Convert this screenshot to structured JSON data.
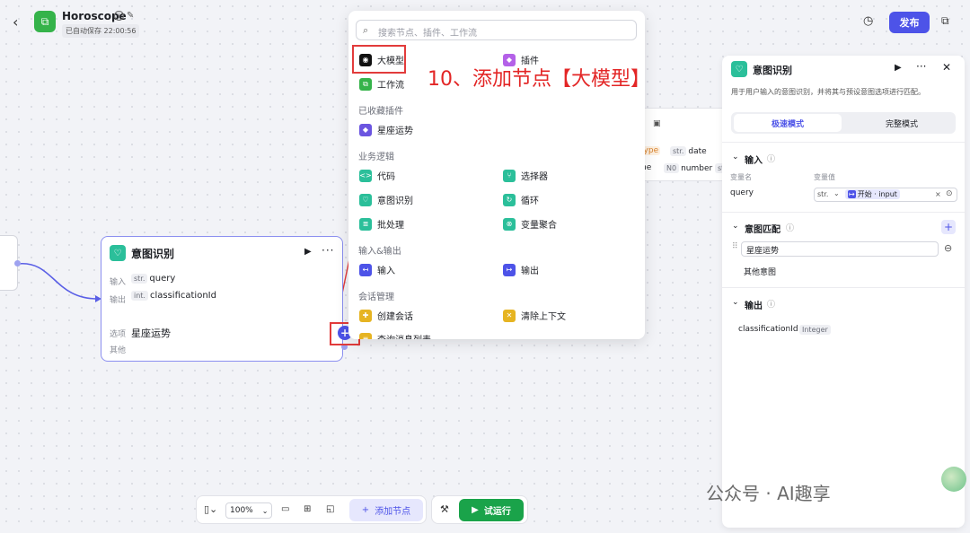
{
  "header": {
    "title": "Horoscope",
    "saved": "已自动保存 22:00:56",
    "publish": "发布"
  },
  "node": {
    "title": "意图识别",
    "input_label": "输入",
    "input_type": "str.",
    "input_name": "query",
    "output_label": "输出",
    "output_type": "int.",
    "output_name": "classificationId",
    "option_label": "选项",
    "option_value": "星座运势",
    "other_label": "其他"
  },
  "popup": {
    "search_placeholder": "搜索节点、插件、工作流",
    "top_items": [
      {
        "label": "大模型"
      },
      {
        "label": "插件"
      },
      {
        "label": "工作流"
      }
    ],
    "sections": [
      {
        "title": "已收藏插件",
        "items": [
          "星座运势"
        ]
      },
      {
        "title": "业务逻辑",
        "items": [
          "代码",
          "选择器",
          "意图识别",
          "循环",
          "批处理",
          "变量聚合"
        ]
      },
      {
        "title": "输入&输出",
        "items": [
          "输入",
          "输出"
        ]
      },
      {
        "title": "会话管理",
        "items": [
          "创建会话",
          "清除上下文",
          "查询消息列表"
        ]
      }
    ]
  },
  "annotation": "10、添加节点【大模型】",
  "bg_node": {
    "type_tag": "type",
    "type_prefix": "str.",
    "type_val": "date",
    "row2_a": "me",
    "row2_b_prefix": "N0",
    "row2_b": "number",
    "row2_c": "st",
    "title_tail": "y"
  },
  "panel": {
    "title": "意图识别",
    "desc": "用于用户输入的意图识别，并将其与预设意图选项进行匹配。",
    "mode_fast": "极速模式",
    "mode_full": "完整模式",
    "input_section": "输入",
    "var_name_h": "变量名",
    "var_val_h": "变量值",
    "var_name": "query",
    "var_type": "str.",
    "var_ref": "开始 · input",
    "match_section": "意图匹配",
    "match_value": "星座运势",
    "other_intent": "其他意图",
    "output_section": "输出",
    "out_name": "classificationId",
    "out_type": "Integer"
  },
  "toolbar": {
    "zoom": "100%",
    "add_node": "添加节点",
    "run": "试运行"
  },
  "watermark": "公众号 · AI趣享"
}
